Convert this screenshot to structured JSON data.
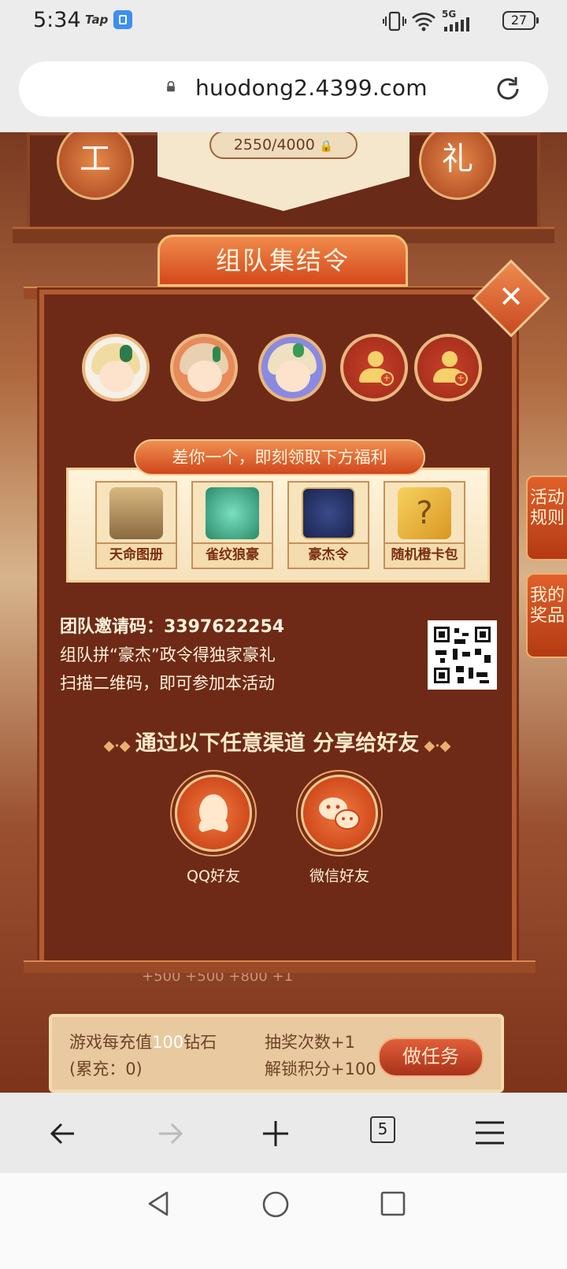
{
  "status_bar": {
    "time": "5:34",
    "app_badge": "Tap",
    "network": "5G",
    "battery": "27"
  },
  "browser": {
    "url": "huodong2.4399.com",
    "tab_count": "5"
  },
  "background": {
    "progress_text": "2550/4000",
    "left_circle_char": "工",
    "right_circle_char": "礼",
    "side_tab_rules": "活动规则",
    "side_tab_prizes": "我的奖品",
    "numbers_row": "+500        +500        +800  +1"
  },
  "task_bar": {
    "line1_prefix": "游戏每充值",
    "line1_highlight": "100",
    "line1_suffix": "钻石",
    "line2": "(累充：0)",
    "reward1": "抽奖次数+1",
    "reward2": "解锁积分+100",
    "button_label": "做任务"
  },
  "modal": {
    "title": "组队集结令",
    "reward_banner": "差你一个，即刻领取下方福利",
    "rewards": [
      {
        "label": "天命图册"
      },
      {
        "label": "雀纹狼豪"
      },
      {
        "label": "豪杰令"
      },
      {
        "label": "随机橙卡包"
      }
    ],
    "invite_code_label": "团队邀请码：3397622254",
    "invite_line2": "组队拼“豪杰”政令得独家豪礼",
    "invite_line3": "扫描二维码，即可参加本活动",
    "share_title": "通过以下任意渠道 分享给好友",
    "share_qq": "QQ好友",
    "share_wechat": "微信好友"
  },
  "colors": {
    "modal_bg": "#6e2a16",
    "accent_orange": "#d4481c",
    "gold": "#f4c890"
  }
}
